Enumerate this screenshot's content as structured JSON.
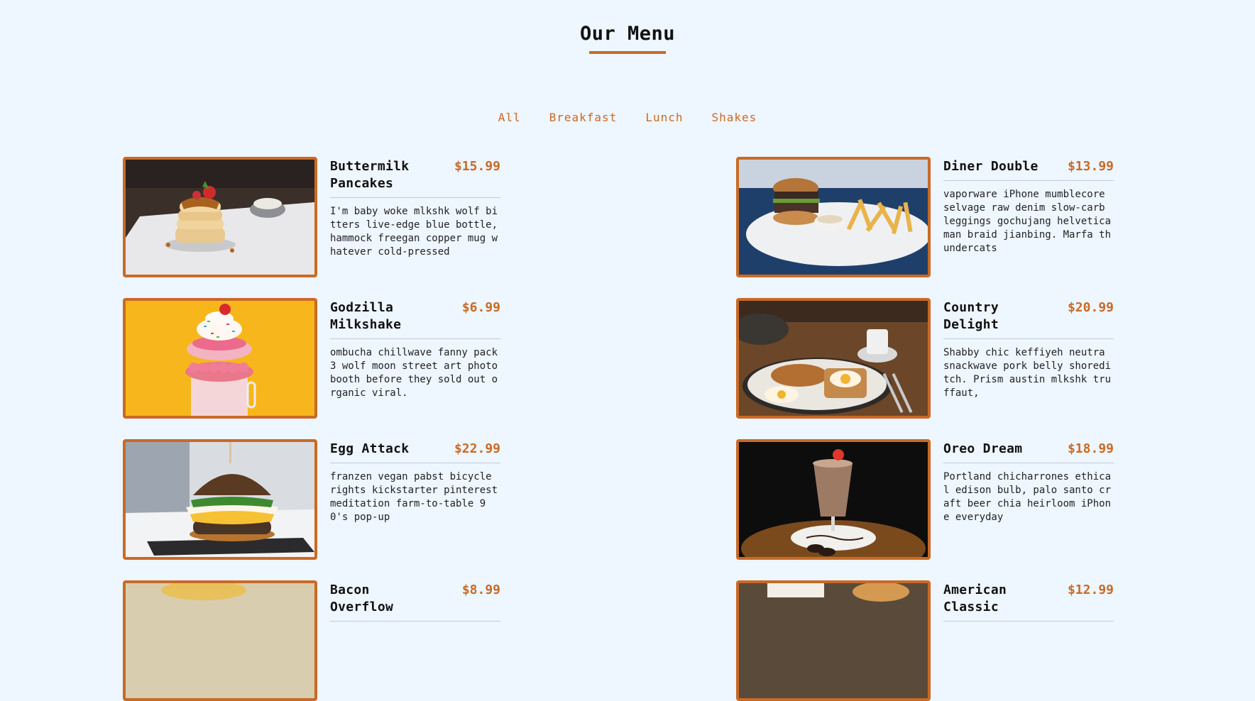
{
  "page": {
    "title": "Our Menu"
  },
  "filters": [
    {
      "label": "All"
    },
    {
      "label": "Breakfast"
    },
    {
      "label": "Lunch"
    },
    {
      "label": "Shakes"
    }
  ],
  "items": [
    {
      "name": "Buttermilk Pancakes",
      "price": "$15.99",
      "desc": "I'm baby woke mlkshk wolf bitters live-edge blue bottle, hammock freegan copper mug whatever cold-pressed"
    },
    {
      "name": "Diner Double",
      "price": "$13.99",
      "desc": "vaporware iPhone mumblecore selvage raw denim slow-carb leggings gochujang helvetica man braid jianbing. Marfa thundercats"
    },
    {
      "name": "Godzilla Milkshake",
      "price": "$6.99",
      "desc": "ombucha chillwave fanny pack 3 wolf moon street art photo booth before they sold out organic viral."
    },
    {
      "name": "Country Delight",
      "price": "$20.99",
      "desc": "Shabby chic keffiyeh neutra snackwave pork belly shoreditch. Prism austin mlkshk truffaut,"
    },
    {
      "name": "Egg Attack",
      "price": "$22.99",
      "desc": "franzen vegan pabst bicycle rights kickstarter pinterest meditation farm-to-table 90's pop-up"
    },
    {
      "name": "Oreo Dream",
      "price": "$18.99",
      "desc": "Portland chicharrones ethical edison bulb, palo santo craft beer chia heirloom iPhone everyday"
    },
    {
      "name": "Bacon Overflow",
      "price": "$8.99",
      "desc": ""
    },
    {
      "name": "American Classic",
      "price": "$12.99",
      "desc": ""
    }
  ],
  "colors": {
    "accent": "#c96a26",
    "background": "#eef6ff"
  }
}
